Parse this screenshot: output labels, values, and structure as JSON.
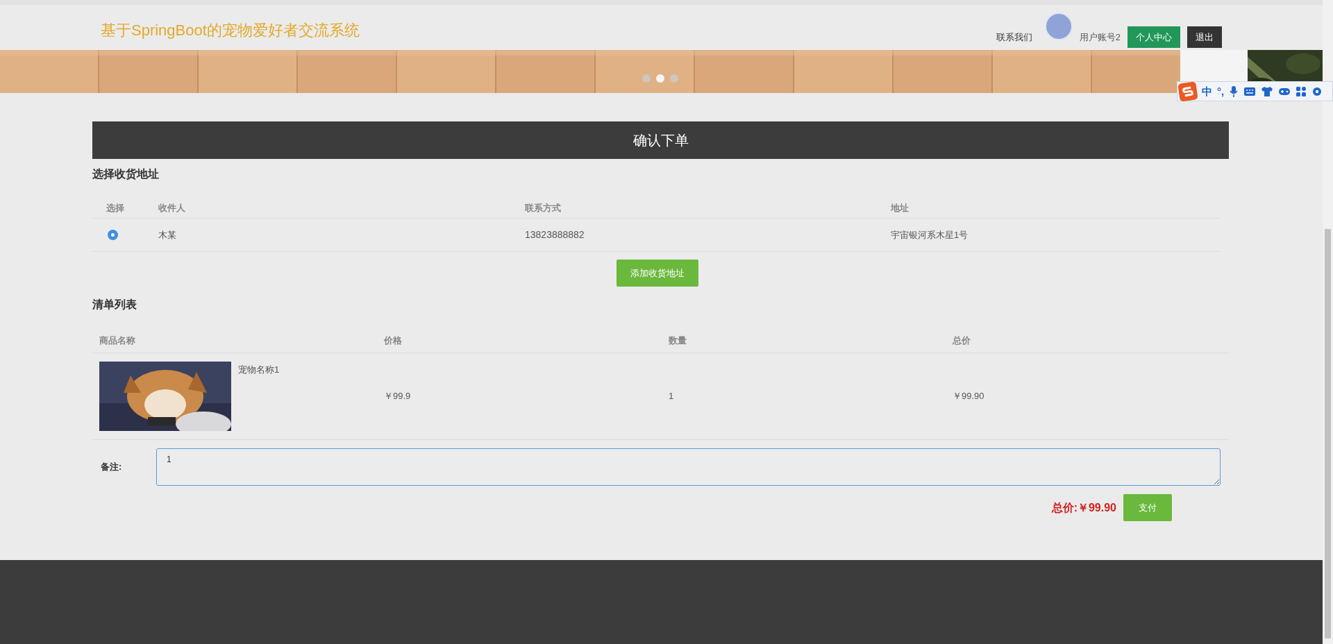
{
  "header": {
    "title": "基于SpringBoot的宠物爱好者交流系统",
    "contact": "联系我们",
    "username": "用户账号2",
    "buttons": [
      "个人中心",
      "退出"
    ]
  },
  "banner": {
    "dots": [
      {
        "selected": false
      },
      {
        "selected": true
      },
      {
        "selected": false
      }
    ]
  },
  "ime_toolbar": {
    "labels": [
      "中",
      "°,"
    ]
  },
  "page_title": "确认下单",
  "address": {
    "title": "选择收货地址",
    "columns": [
      "选择",
      "收件人",
      "联系方式",
      "地址"
    ],
    "rows": [
      {
        "selected": true,
        "name": "木某",
        "phone": "13823888882",
        "address": "宇宙银河系木星1号"
      }
    ],
    "add_button": "添加收货地址"
  },
  "list": {
    "title": "清单列表",
    "columns": [
      "商品名称",
      "价格",
      "数量",
      "总价"
    ],
    "rows": [
      {
        "kind": "picture",
        "name": "宠物名称1",
        "price": "￥99.9",
        "quantity": "1",
        "total": "￥99.90"
      }
    ]
  },
  "note": {
    "label": "备注:",
    "value": "1"
  },
  "total": {
    "label": "总价:",
    "value": "￥99.90"
  },
  "pay_button": "支付"
}
